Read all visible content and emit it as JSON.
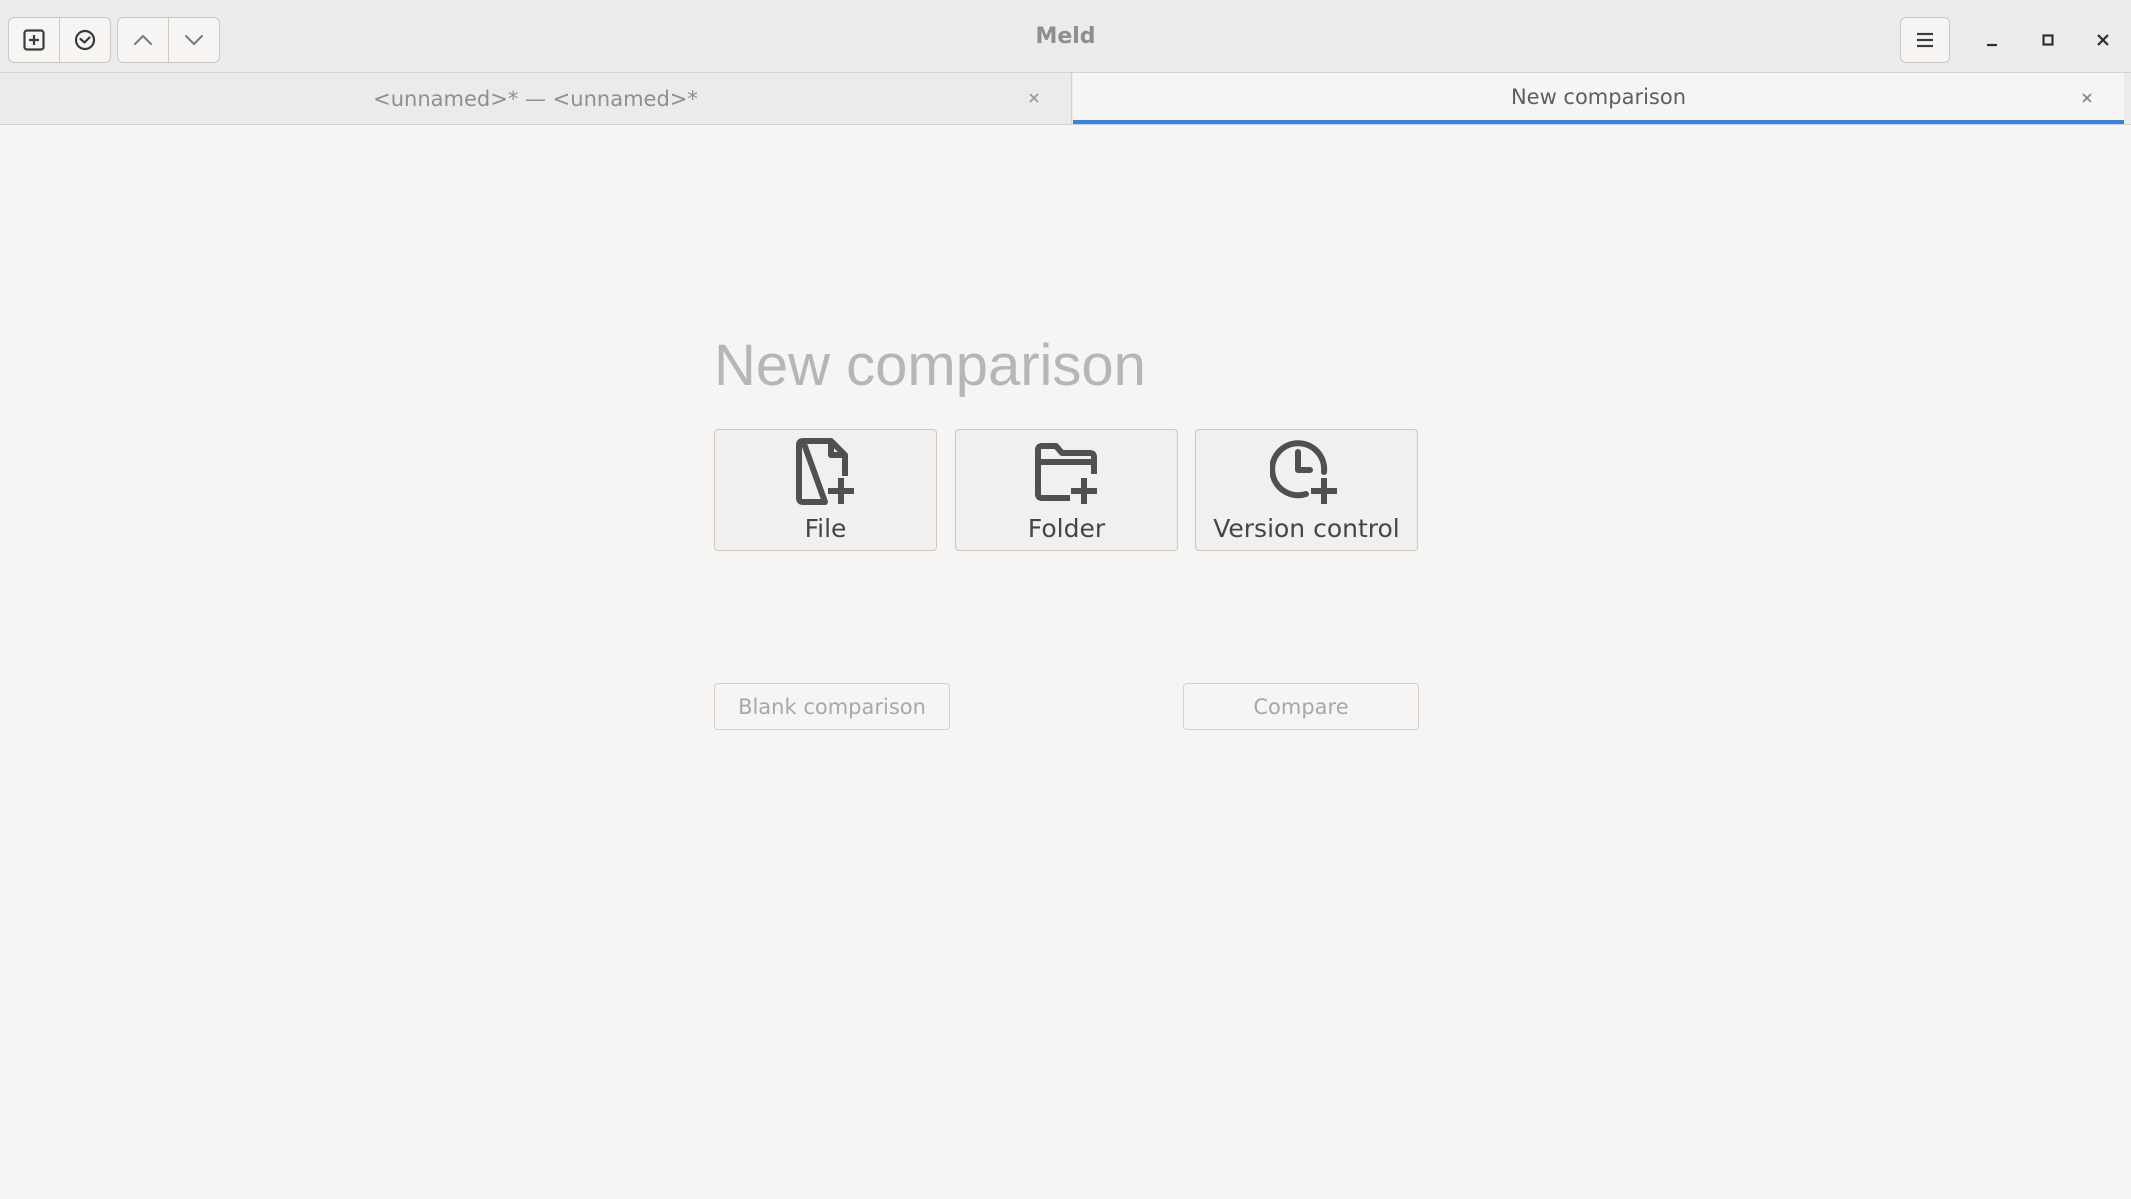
{
  "window": {
    "title": "Meld"
  },
  "headerbar": {
    "buttons": [
      {
        "icon": "new-tab-icon"
      },
      {
        "icon": "recent-icon"
      },
      {
        "icon": "previous-change-icon"
      },
      {
        "icon": "next-change-icon"
      }
    ],
    "menu_icon": "hamburger-menu-icon",
    "window_controls": [
      "minimize-icon",
      "maximize-icon",
      "close-icon"
    ]
  },
  "tabs": [
    {
      "label": "<unnamed>* — <unnamed>*",
      "active": false
    },
    {
      "label": "New comparison",
      "active": true
    }
  ],
  "main": {
    "heading": "New comparison",
    "choices": [
      {
        "label": "File",
        "icon": "file-add-icon"
      },
      {
        "label": "Folder",
        "icon": "folder-add-icon"
      },
      {
        "label": "Version control",
        "icon": "version-control-add-icon"
      }
    ],
    "blank_label": "Blank comparison",
    "compare_label": "Compare"
  },
  "colors": {
    "accent": "#3584e4",
    "background": "#f6f5f4",
    "headerbar": "#ebebeb",
    "icon": "#505050"
  }
}
